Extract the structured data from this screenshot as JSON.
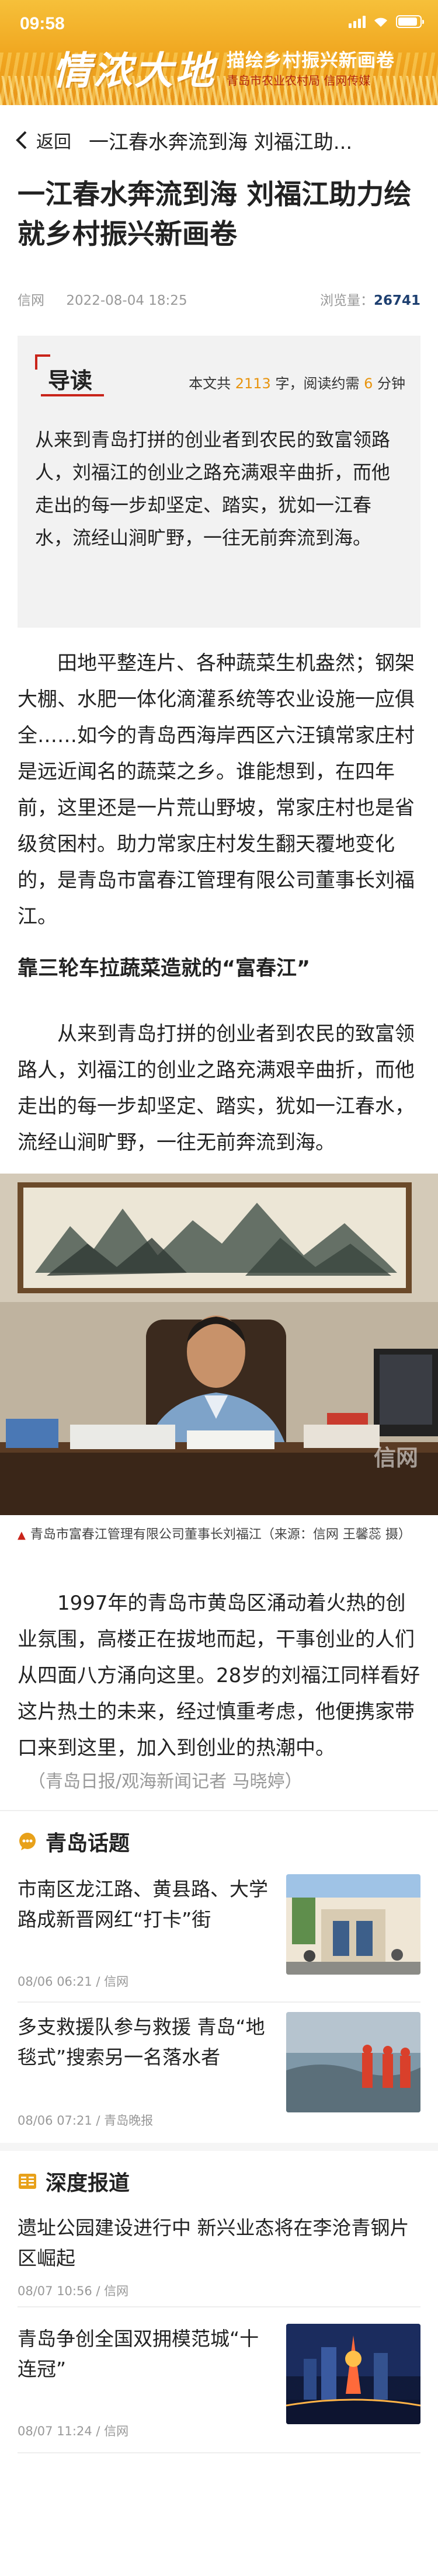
{
  "status_bar": {
    "time": "09:58"
  },
  "banner": {
    "logo": "情浓大地",
    "title": "描绘乡村振兴新画卷",
    "subtitle": "青岛市农业农村局 信网传媒"
  },
  "nav": {
    "back_label": "返回",
    "title": "一江春水奔流到海 刘福江助..."
  },
  "article": {
    "headline": "一江春水奔流到海 刘福江助力绘就乡村振兴新画卷",
    "source": "信网",
    "date": "2022-08-04 18:25",
    "views_label": "浏览量：",
    "views": "26741",
    "summary_tag": "导读",
    "word_prefix": "本文共 ",
    "word_count": "2113",
    "word_mid": " 字，阅读约需 ",
    "read_minutes": "6",
    "word_suffix": " 分钟",
    "summary": "从来到青岛打拼的创业者到农民的致富领路人，刘福江的创业之路充满艰辛曲折，而他走出的每一步却坚定、踏实，犹如一江春水，流经山涧旷野，一往无前奔流到海。",
    "para1": "田地平整连片、各种蔬菜生机盎然；钢架大棚、水肥一体化滴灌系统等农业设施一应俱全……如今的青岛西海岸西区六汪镇常家庄村是远近闻名的蔬菜之乡。谁能想到，在四年前，这里还是一片荒山野坡，常家庄村也是省级贫困村。助力常家庄村发生翻天覆地变化的，是青岛市富春江管理有限公司董事长刘福江。",
    "subhead": "靠三轮车拉蔬菜造就的“富春江”",
    "para2": "从来到青岛打拼的创业者到农民的致富领路人，刘福江的创业之路充满艰辛曲折，而他走出的每一步却坚定、踏实，犹如一江春水，流经山涧旷野，一往无前奔流到海。",
    "photo_watermark": "信网",
    "photo_caption": "青岛市富春江管理有限公司董事长刘福江（来源：信网 王馨蕊 摄）",
    "para3": "1997年的青岛市黄岛区涌动着火热的创业氛围，高楼正在拔地而起，干事创业的人们从四面八方涌向这里。28岁的刘福江同样看好这片热土的未来，经过慎重考虑，他便携家带口来到这里，加入到创业的热潮中。",
    "byline": "（青岛日报/观海新闻记者 马晓婷）"
  },
  "sections": [
    {
      "title": "青岛话题",
      "icon": "chat-bubble-icon",
      "items": [
        {
          "title": "市南区龙江路、黄县路、大学路成新晋网红“打卡”街",
          "info": "08/06 06:21 / 信网"
        },
        {
          "title": "多支救援队参与救援 青岛“地毯式”搜索另一名落水者",
          "info": "08/06 07:21 / 青岛晚报"
        }
      ]
    },
    {
      "title": "深度报道",
      "icon": "open-book-icon",
      "items": [
        {
          "title": "遗址公园建设进行中 新兴业态将在李沧青钢片区崛起",
          "info": "08/07 10:56 / 信网"
        },
        {
          "title": "青岛争创全国双拥模范城“十连冠”",
          "info": "08/07 11:24 / 信网"
        }
      ]
    }
  ],
  "colors": {
    "banner": "#f0a51e",
    "accent_red": "#c9241a",
    "highlight_orange": "#e8940e",
    "views_blue": "#1d3f70"
  }
}
